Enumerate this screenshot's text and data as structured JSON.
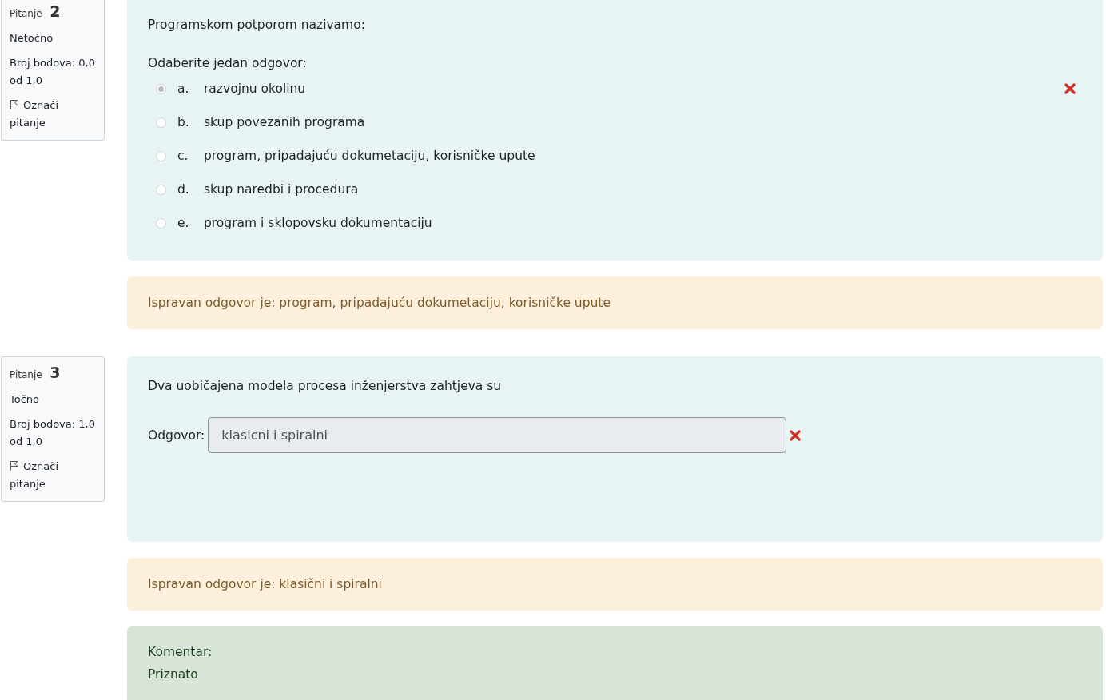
{
  "questions": [
    {
      "kind": "multichoice",
      "label": "Pitanje",
      "number": "2",
      "state": "Netočno",
      "marks": "Broj bodova: 0,0 od 1,0",
      "flag": "Označi pitanje",
      "text": "Programskom potporom nazivamo:",
      "prompt": "Odaberite jedan odgovor:",
      "options": [
        {
          "letter": "a.",
          "text": "razvojnu okolinu",
          "selected": true,
          "incorrect": true
        },
        {
          "letter": "b.",
          "text": "skup povezanih programa",
          "selected": false,
          "incorrect": false
        },
        {
          "letter": "c.",
          "text": "program, pripadajuću dokumetaciju, korisničke upute",
          "selected": false,
          "incorrect": false
        },
        {
          "letter": "d.",
          "text": "skup naredbi i procedura",
          "selected": false,
          "incorrect": false
        },
        {
          "letter": "e.",
          "text": "program i sklopovsku dokumentaciju",
          "selected": false,
          "incorrect": false
        }
      ],
      "right_answer": "Ispravan odgovor je: program, pripadajuću dokumetaciju, korisničke upute"
    },
    {
      "kind": "shortanswer",
      "label": "Pitanje",
      "number": "3",
      "state": "Točno",
      "marks": "Broj bodova: 1,0 od 1,0",
      "flag": "Označi pitanje",
      "text": "Dva uobičajena modela procesa inženjerstva zahtjeva su",
      "answer_label": "Odgovor:",
      "answer": "klasicni i spiralni",
      "answer_incorrect": true,
      "right_answer": "Ispravan odgovor je: klasični i spiralni",
      "comment": {
        "title": "Komentar:",
        "text": "Priznato"
      }
    }
  ]
}
